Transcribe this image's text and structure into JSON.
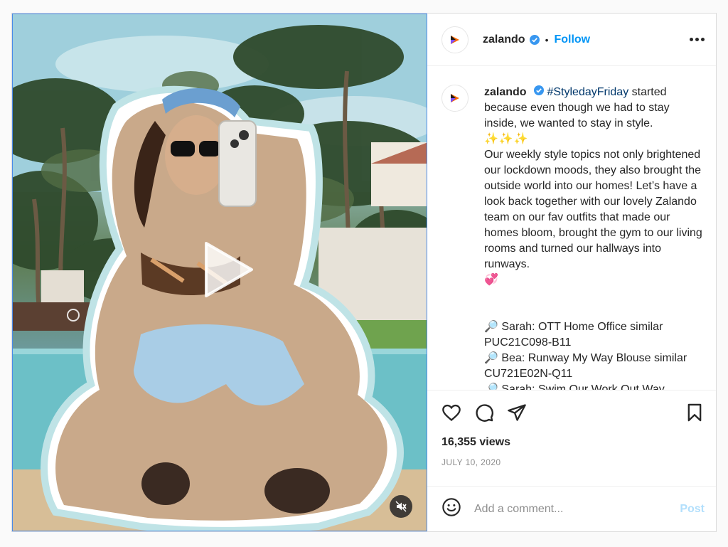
{
  "account": {
    "username": "zalando",
    "verified": true
  },
  "header": {
    "follow_label": "Follow",
    "separator": "•"
  },
  "caption": {
    "username": "zalando",
    "hashtag": "#StyledayFriday",
    "line_1": " started because even though we had to stay inside, we wanted to stay in style.",
    "sparkles": "✨✨✨",
    "paragraph_2": "Our weekly style topics not only brightened our lockdown moods, they also brought the outside world into our homes! Let’s have a look back together with our lovely Zalando team on our fav outfits that made our homes bloom, brought the gym to our living rooms and turned our hallways into runways.",
    "heart": "💞",
    "items": [
      {
        "icon": "🔎",
        "text": "Sarah: OTT Home Office similar PUC21C098-B11"
      },
      {
        "icon": "🔎",
        "text": "Bea: Runway My Way Blouse similar CU721E02N-Q11"
      },
      {
        "icon": "🔎",
        "text": "Sarah: Swim Our Work Out Way"
      }
    ]
  },
  "stats": {
    "views": "16,355 views",
    "date": "JULY 10, 2020"
  },
  "comment": {
    "placeholder": "Add a comment...",
    "post_label": "Post"
  },
  "icons": {
    "avatar": "zalando-logo-icon",
    "verified": "verified-badge-icon",
    "like": "heart-icon",
    "comment": "comment-icon",
    "share": "paper-plane-icon",
    "save": "bookmark-icon",
    "emoji": "smiley-icon",
    "mute": "speaker-muted-icon",
    "play": "play-icon"
  },
  "colors": {
    "accent": "#0095f6",
    "hashtag": "#00376b",
    "post_disabled": "#b2dffc",
    "muted_text": "#8e8e8e"
  }
}
